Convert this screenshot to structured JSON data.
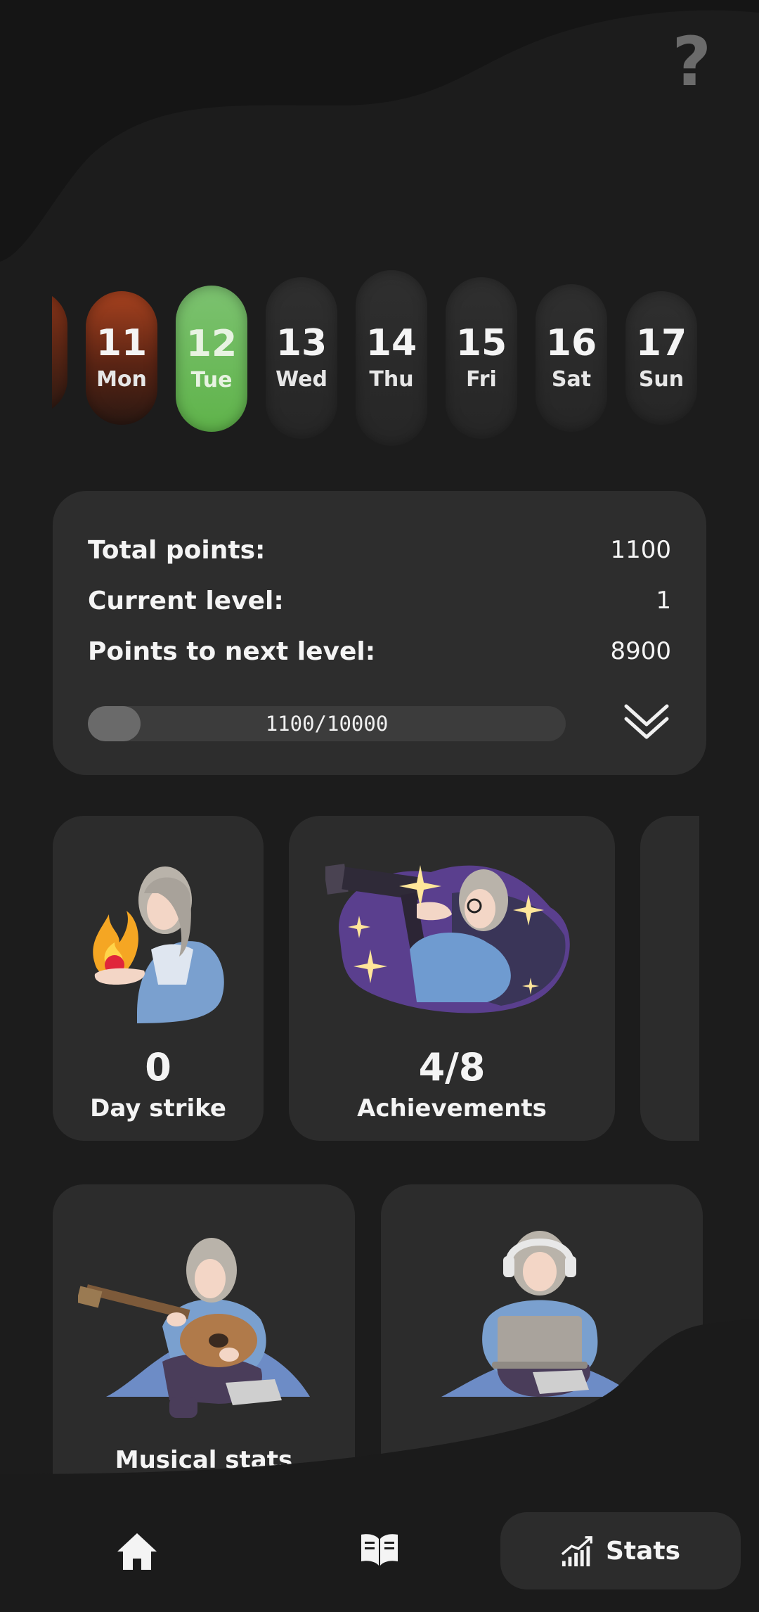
{
  "header": {
    "help_icon": "help-question-icon",
    "help_glyph": "?"
  },
  "days": [
    {
      "num": "11",
      "name": "Mon",
      "state": "missed"
    },
    {
      "num": "12",
      "name": "Tue",
      "state": "today"
    },
    {
      "num": "13",
      "name": "Wed",
      "state": "default"
    },
    {
      "num": "14",
      "name": "Thu",
      "state": "default"
    },
    {
      "num": "15",
      "name": "Fri",
      "state": "default"
    },
    {
      "num": "16",
      "name": "Sat",
      "state": "default"
    },
    {
      "num": "17",
      "name": "Sun",
      "state": "default"
    }
  ],
  "points": {
    "total_label": "Total points:",
    "total_value": "1100",
    "level_label": "Current level:",
    "level_value": "1",
    "next_label": "Points to next level:",
    "next_value": "8900",
    "progress_text": "1100/10000",
    "progress_fraction": 0.11
  },
  "cards": {
    "streak_value": "0",
    "streak_label": "Day strike",
    "achievements_value": "4/8",
    "achievements_label": "Achievements",
    "musical_label": "Musical stats"
  },
  "nav": {
    "home_icon": "home-icon",
    "book_icon": "book-icon",
    "stats_icon": "stats-chart-icon",
    "stats_label": "Stats"
  },
  "colors": {
    "background": "#1c1c1c",
    "card": "#2d2d2d",
    "today_green": "#6bbb55",
    "missed_red": "#a8421f"
  }
}
